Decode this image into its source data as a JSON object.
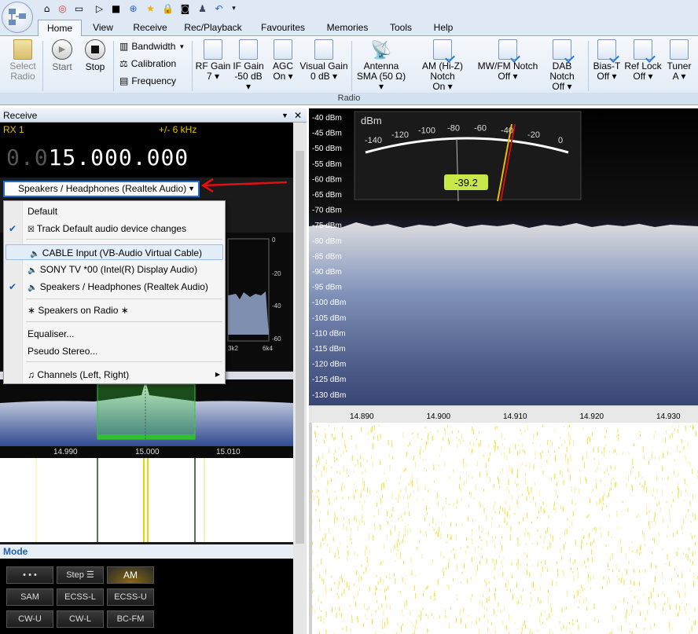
{
  "tabs": [
    "Home",
    "View",
    "Receive",
    "Rec/Playback",
    "Favourites",
    "Memories",
    "Tools",
    "Help"
  ],
  "ribbon": {
    "select_radio": [
      "Select",
      "Radio"
    ],
    "start": "Start",
    "stop": "Stop",
    "bandwidth": "Bandwidth",
    "calibration": "Calibration",
    "frequency": "Frequency",
    "controls": [
      {
        "l1": "RF Gain",
        "l2": "7"
      },
      {
        "l1": "IF Gain",
        "l2": "-50 dB"
      },
      {
        "l1": "AGC",
        "l2": "On"
      },
      {
        "l1": "Visual Gain",
        "l2": "0 dB"
      },
      {
        "l1": "Antenna",
        "l2": "SMA (50 Ω)"
      },
      {
        "l1": "AM (Hi-Z) Notch",
        "l2": "On"
      },
      {
        "l1": "MW/FM Notch",
        "l2": "Off"
      },
      {
        "l1": "DAB Notch",
        "l2": "Off"
      },
      {
        "l1": "Bias-T",
        "l2": "Off"
      },
      {
        "l1": "Ref Lock",
        "l2": "Off"
      },
      {
        "l1": "Tuner",
        "l2": "A"
      }
    ],
    "group_label": "Radio"
  },
  "left": {
    "title": "Receive",
    "rx": "RX 1",
    "bw": "+/- 6 kHz",
    "freq_dim": "0.0",
    "freq_main": "15.000.000",
    "audio_device": "Speakers / Headphones (Realtek Audio)",
    "menu": [
      {
        "label": "Default",
        "check": false
      },
      {
        "label": "Track Default audio device changes",
        "check": true
      },
      {
        "label": "CABLE Input (VB-Audio Virtual Cable)",
        "check": false,
        "hl": true
      },
      {
        "label": "SONY TV  *00 (Intel(R) Display Audio)",
        "check": false
      },
      {
        "label": "Speakers / Headphones (Realtek Audio)",
        "check": true
      },
      {
        "label": "∗ Speakers on Radio ∗",
        "check": false
      },
      {
        "label": "Equaliser...",
        "check": false
      },
      {
        "label": "Pseudo Stereo...",
        "check": false
      },
      {
        "label": "Channels (Left, Right)",
        "check": false
      }
    ],
    "spec_db": [
      "0",
      "-20",
      "-40",
      "-60"
    ],
    "spec_freq": [
      "3k2",
      "6k4"
    ],
    "mini_freq": [
      "14.990",
      "15.000",
      "15.010"
    ],
    "mode_title": "Mode",
    "mode_buttons": [
      "• • •",
      "Step ☰",
      "AM",
      "SAM",
      "ECSS-L",
      "ECSS-U",
      "CW-U",
      "CW-L",
      "BC-FM"
    ]
  },
  "right": {
    "db_labels": [
      "-40 dBm",
      "-45 dBm",
      "-50 dBm",
      "-55 dBm",
      "-60 dBm",
      "-65 dBm",
      "-70 dBm",
      "-75 dBm",
      "-80 dBm",
      "-85 dBm",
      "-90 dBm",
      "-95 dBm",
      "-100 dBm",
      "-105 dBm",
      "-110 dBm",
      "-115 dBm",
      "-120 dBm",
      "-125 dBm",
      "-130 dBm"
    ],
    "freq_labels": [
      "14.890",
      "14.900",
      "14.910",
      "14.920",
      "14.930"
    ],
    "meter": {
      "unit": "dBm",
      "scale": [
        "-140",
        "-120",
        "-100",
        "-80",
        "-60",
        "-40",
        "-20",
        "0"
      ],
      "value": "-39.2"
    }
  },
  "colors": {
    "accent": "#1e6fd0",
    "freq_yellow": "#e8c000",
    "meter_badge": "#c8e84a"
  }
}
